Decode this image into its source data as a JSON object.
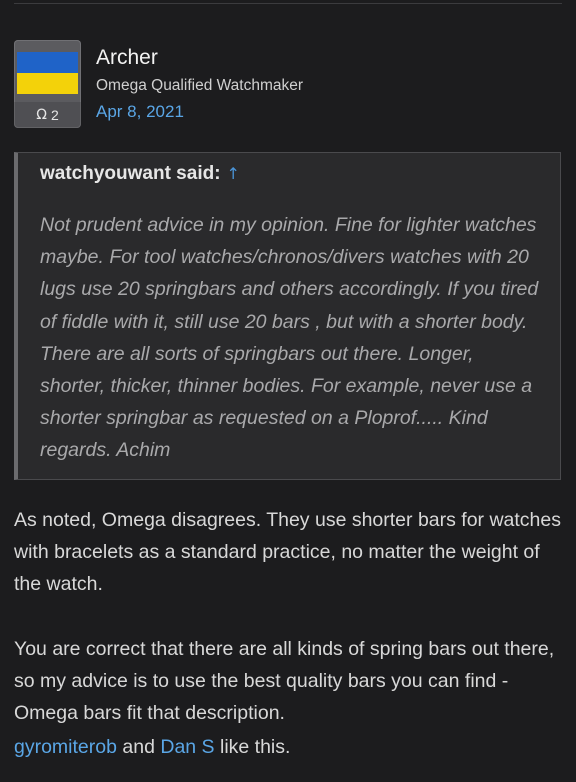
{
  "post": {
    "author": {
      "name": "Archer",
      "title": "Omega Qualified Watchmaker",
      "date": "Apr 8, 2021",
      "avatar": {
        "flag_colors": [
          "#1f63c8",
          "#f3d20a"
        ],
        "badge_icon": "omega-icon",
        "badge_symbol": "Ω",
        "badge_count": "2"
      }
    },
    "quote": {
      "author": "watchyouwant said:",
      "arrow": "↑",
      "text": "Not prudent advice in my opinion. Fine for lighter watches maybe. For tool watches/chronos/divers watches with 20 lugs use 20 springbars and others accordingly. If you tired of fiddle with it, still use 20 bars , but with a shorter body. There are all sorts of springbars out there. Longer, shorter, thicker, thinner bodies. For example, never use a shorter springbar as requested on a Ploprof..... Kind regards. Achim"
    },
    "body": [
      "As noted, Omega disagrees. They use shorter bars for watches with bracelets as a standard practice, no matter the weight of the watch.",
      "You are correct that there are all kinds of spring bars out there, so my advice is to use the best quality bars you can find - Omega bars fit that description."
    ],
    "likes": {
      "user1": "gyromiterob",
      "and": "and",
      "user2": "Dan S",
      "suffix": "like this."
    }
  },
  "colors": {
    "background": "#1c1c1e",
    "link": "#5aa6e6",
    "quote_bg": "#2a2a2c"
  }
}
